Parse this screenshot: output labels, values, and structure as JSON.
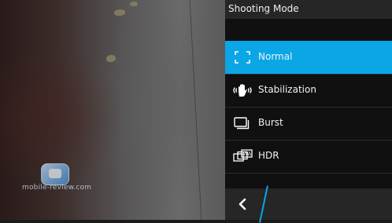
{
  "panel": {
    "title": "Shooting Mode",
    "items": [
      {
        "label": "Normal",
        "icon": "focus-brackets-icon",
        "selected": true
      },
      {
        "label": "Stabilization",
        "icon": "shaking-hand-icon",
        "selected": false
      },
      {
        "label": "Burst",
        "icon": "stacked-frames-icon",
        "selected": false
      },
      {
        "label": "HDR",
        "icon": "hdr-frames-icon",
        "selected": false
      }
    ],
    "back_icon": "chevron-left-icon"
  },
  "watermark": {
    "text": "mobile-review.com"
  },
  "colors": {
    "accent": "#0aa6e6",
    "panel_bg": "#101010",
    "header_bg": "#262626"
  }
}
